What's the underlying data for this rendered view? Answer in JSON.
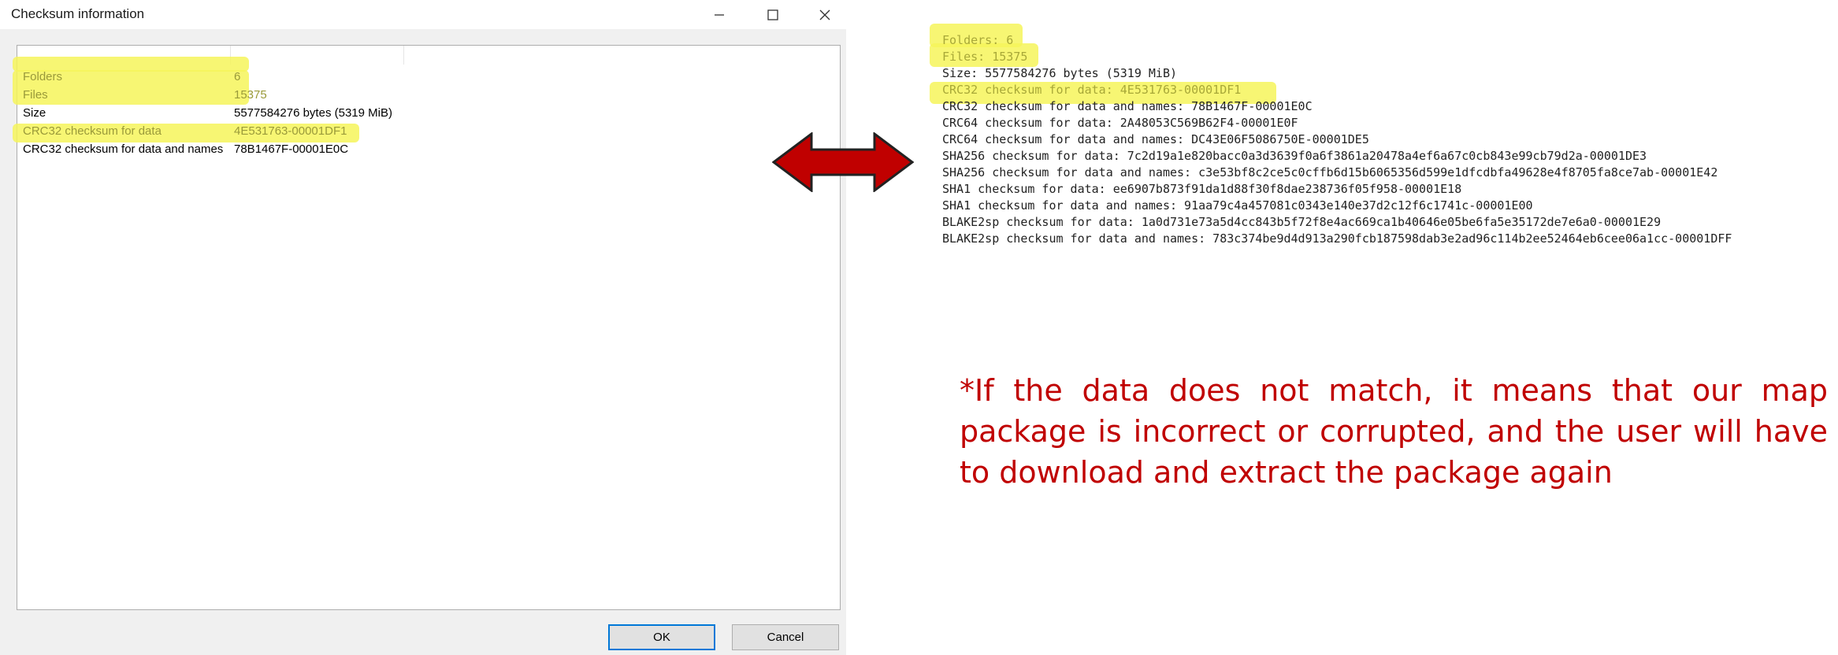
{
  "dialog": {
    "title": "Checksum information",
    "rows": [
      {
        "name": "Folders",
        "value": "6",
        "highlighted": true
      },
      {
        "name": "Files",
        "value": "15375",
        "highlighted": true
      },
      {
        "name": "Size",
        "value": "5577584276 bytes (5319 MiB)",
        "highlighted": false
      },
      {
        "name": "CRC32 checksum for data",
        "value": "4E531763-00001DF1",
        "highlighted": true
      },
      {
        "name": "CRC32 checksum for data and names",
        "value": "78B1467F-00001E0C",
        "highlighted": false
      }
    ],
    "ok_label": "OK",
    "cancel_label": "Cancel"
  },
  "output": {
    "lines": [
      "Folders: 6",
      "Files: 15375",
      "Size: 5577584276 bytes (5319 MiB)",
      "CRC32 checksum for data: 4E531763-00001DF1",
      "CRC32 checksum for data and names: 78B1467F-00001E0C",
      "CRC64 checksum for data: 2A48053C569B62F4-00001E0F",
      "CRC64 checksum for data and names: DC43E06F5086750E-00001DE5",
      "SHA256 checksum for data: 7c2d19a1e820bacc0a3d3639f0a6f3861a20478a4ef6a67c0cb843e99cb79d2a-00001DE3",
      "SHA256 checksum for data and names: c3e53bf8c2ce5c0cffb6d15b6065356d599e1dfcdbfa49628e4f8705fa8ce7ab-00001E42",
      "SHA1 checksum for data: ee6907b873f91da1d88f30f8dae238736f05f958-00001E18",
      "SHA1 checksum for data and names: 91aa79c4a457081c0343e140e37d2c12f6c1741c-00001E00",
      "BLAKE2sp checksum for data: 1a0d731e73a5d4cc843b5f72f8e4ac669ca1b40646e05be6fa5e35172de7e6a0-00001E29",
      "BLAKE2sp checksum for data and names: 783c374be9d4d913a290fcb187598dab3e2ad96c114b2ee52464eb6cee06a1cc-00001DFF"
    ],
    "highlighted_indices": [
      0,
      1,
      3
    ]
  },
  "note": "*If the data does not match, it means that our map package is incorrect or corrupted, and the user will have to download and extract the package again",
  "colors": {
    "highlight": "#f6f55a",
    "arrow_fill": "#c00000",
    "note_text": "#c00000",
    "ok_border": "#0078d7"
  }
}
